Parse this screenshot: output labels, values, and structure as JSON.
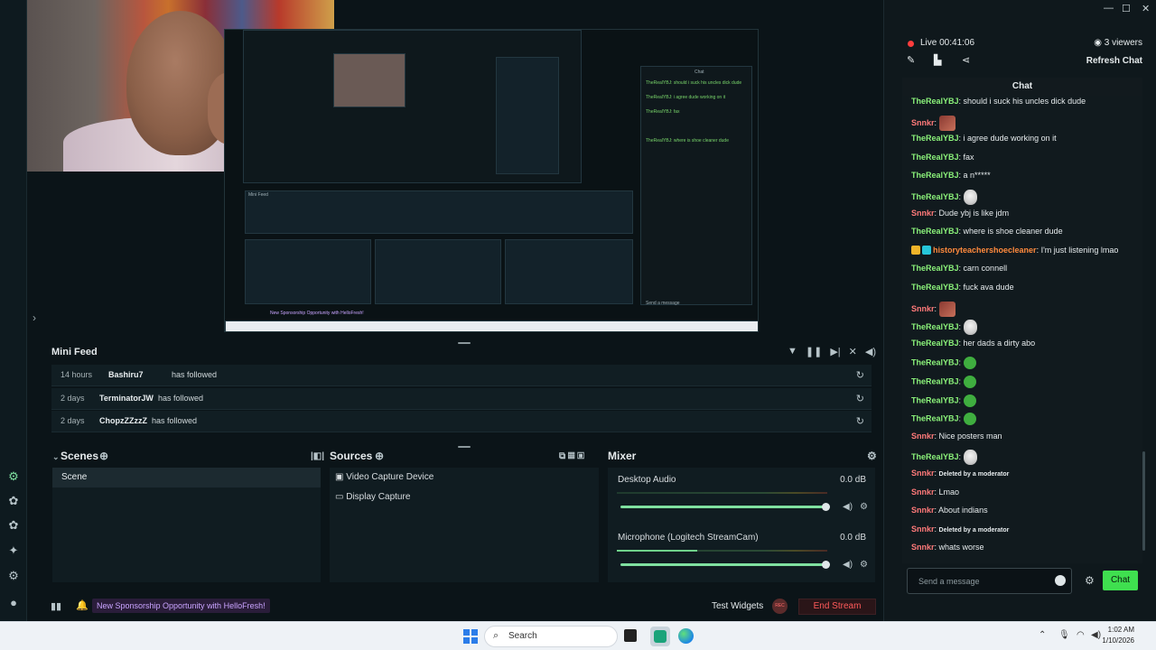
{
  "mini_feed": {
    "title": "Mini Feed",
    "rows": [
      {
        "time": "14 hours",
        "user": "Bashiru7",
        "action": "has followed"
      },
      {
        "time": "2 days",
        "user": "TerminatorJW",
        "action": "has followed"
      },
      {
        "time": "2 days",
        "user": "ChopzZZzzZ",
        "action": "has followed"
      }
    ]
  },
  "scenes": {
    "title": "Scenes",
    "items": [
      "Scene"
    ]
  },
  "sources": {
    "title": "Sources",
    "items": [
      "Video Capture Device",
      "Display Capture"
    ]
  },
  "mixer": {
    "title": "Mixer",
    "channels": [
      {
        "name": "Desktop Audio",
        "db": "0.0 dB",
        "level": 0.0,
        "volume": 1.0
      },
      {
        "name": "Microphone (Logitech StreamCam)",
        "db": "0.0 dB",
        "level": 0.38,
        "volume": 1.0
      }
    ]
  },
  "status_bar": {
    "sponsorship": "New Sponsorship Opportunity with HelloFresh!",
    "test_widgets": "Test Widgets",
    "rec": "REC",
    "end_stream": "End Stream"
  },
  "stream_info": {
    "live": "Live 00:41:06",
    "viewers": "3 viewers",
    "refresh_chat": "Refresh Chat"
  },
  "chat": {
    "title": "Chat",
    "input_placeholder": "Send a message",
    "send_label": "Chat",
    "user_colors": {
      "TheRealYBJ": "#8bf27a",
      "Snnkr": "#ff7a7a",
      "historyteachershoecleaner": "#ff8a3d"
    },
    "messages": [
      {
        "user": "TheRealYBJ",
        "text": "should i suck his uncles dick dude"
      },
      {
        "user": "Snnkr",
        "emote": "pic"
      },
      {
        "user": "TheRealYBJ",
        "text": "i agree dude working on it"
      },
      {
        "user": "TheRealYBJ",
        "text": "fax"
      },
      {
        "user": "TheRealYBJ",
        "text": "a n*****"
      },
      {
        "user": "TheRealYBJ",
        "emote": "skull"
      },
      {
        "user": "Snnkr",
        "text": "Dude ybj is like jdm"
      },
      {
        "user": "TheRealYBJ",
        "text": "where is shoe cleaner dude"
      },
      {
        "user": "historyteachershoecleaner",
        "text": "I'm just listening lmao",
        "badges": true
      },
      {
        "user": "TheRealYBJ",
        "text": "carn connell"
      },
      {
        "user": "TheRealYBJ",
        "text": "fuck ava dude"
      },
      {
        "user": "Snnkr",
        "emote": "pic"
      },
      {
        "user": "TheRealYBJ",
        "emote": "skull"
      },
      {
        "user": "TheRealYBJ",
        "text": "her dads a dirty abo"
      },
      {
        "user": "TheRealYBJ",
        "emote": "green"
      },
      {
        "user": "TheRealYBJ",
        "emote": "green"
      },
      {
        "user": "TheRealYBJ",
        "emote": "green"
      },
      {
        "user": "TheRealYBJ",
        "emote": "green"
      },
      {
        "user": "Snnkr",
        "text": "Nice posters man"
      },
      {
        "user": "TheRealYBJ",
        "emote": "skull"
      },
      {
        "user": "Snnkr",
        "text": "Deleted by a moderator",
        "deleted": true
      },
      {
        "user": "Snnkr",
        "text": "Lmao"
      },
      {
        "user": "Snnkr",
        "text": "About indians"
      },
      {
        "user": "Snnkr",
        "text": "Deleted by a moderator",
        "deleted": true
      },
      {
        "user": "Snnkr",
        "text": "whats worse"
      }
    ]
  },
  "taskbar": {
    "search": "Search",
    "time": "1:02 AM",
    "date": "1/10/2026"
  },
  "colors": {
    "accent": "#3fdf4f",
    "end_stream": "#ff5a5a",
    "sponsor": "#c9a4ff",
    "background": "#0b1418"
  }
}
